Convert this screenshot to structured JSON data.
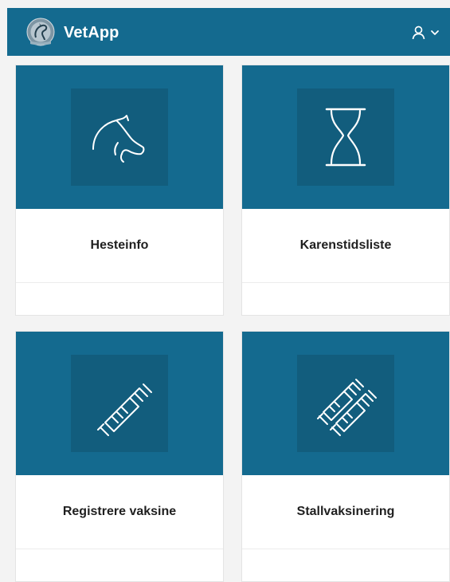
{
  "header": {
    "app_name": "VetApp",
    "logo_icon": "horse-emblem-icon",
    "user_icon": "user-icon",
    "menu_icon": "chevron-down-icon"
  },
  "colors": {
    "brand": "#146a8f",
    "icon_box": "#125d7d",
    "background": "#f3f3f3"
  },
  "cards": [
    {
      "label": "Hesteinfo",
      "icon": "horse-head-icon"
    },
    {
      "label": "Karenstidsliste",
      "icon": "hourglass-icon"
    },
    {
      "label": "Registrere vaksine",
      "icon": "syringe-icon"
    },
    {
      "label": "Stallvaksinering",
      "icon": "multiple-syringes-icon"
    }
  ]
}
